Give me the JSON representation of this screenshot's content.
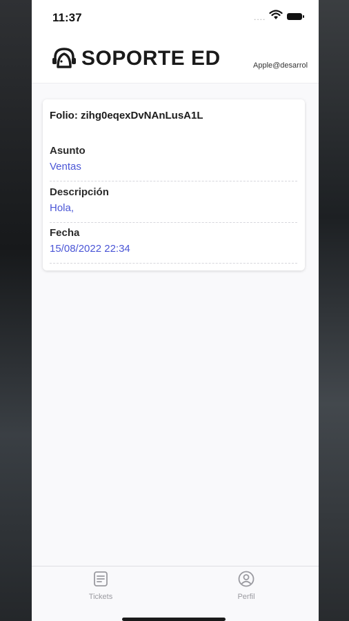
{
  "status_bar": {
    "time": "11:37",
    "signal": "....",
    "icons": [
      "wifi-icon",
      "battery-icon"
    ]
  },
  "header": {
    "brand": "SOPORTE ED",
    "user_email": "Apple@desarrol",
    "logo_icon": "support-agent-icon"
  },
  "ticket": {
    "folio": "Folio: zihg0eqexDvNAnLusA1L",
    "fields": [
      {
        "label": "Asunto",
        "value": "Ventas"
      },
      {
        "label": "Descripción",
        "value": "Hola,"
      },
      {
        "label": "Fecha",
        "value": "15/08/2022 22:34"
      }
    ]
  },
  "tabbar": {
    "tabs": [
      {
        "label": "Tickets",
        "icon": "document-icon"
      },
      {
        "label": "Perfil",
        "icon": "user-circle-icon"
      }
    ]
  },
  "colors": {
    "accent": "#4a55d6",
    "label": "#2a2a2a",
    "tab_inactive": "#9a9aa0"
  }
}
